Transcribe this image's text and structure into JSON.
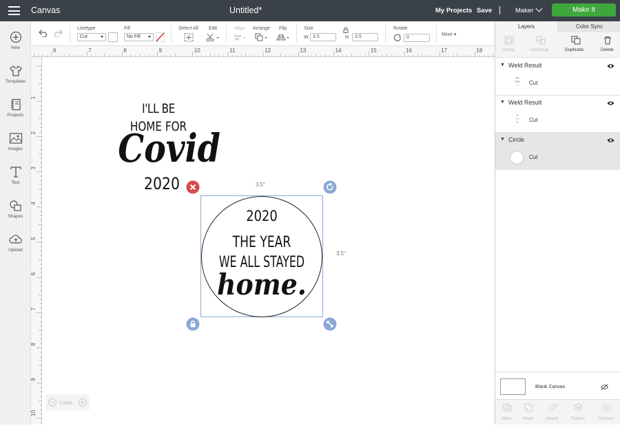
{
  "topbar": {
    "app_title": "Canvas",
    "doc_title": "Untitled*",
    "my_projects": "My Projects",
    "save": "Save",
    "machine": "Maker",
    "make_it": "Make It"
  },
  "toolbar": {
    "linetype_label": "Linetype",
    "linetype_value": "Cut",
    "fill_label": "Fill",
    "fill_value": "No Fill",
    "select_all": "Select All",
    "edit": "Edit",
    "align": "Align",
    "arrange": "Arrange",
    "flip": "Flip",
    "size_label": "Size",
    "w_label": "W",
    "w_value": "3.5",
    "h_label": "H",
    "h_value": "3.5",
    "rotate_label": "Rotate",
    "rotate_value": "0",
    "more": "More"
  },
  "left_rail": {
    "items": [
      {
        "label": "New",
        "icon": "plus-circle-icon"
      },
      {
        "label": "Templates",
        "icon": "tshirt-icon"
      },
      {
        "label": "Projects",
        "icon": "notebook-icon"
      },
      {
        "label": "Images",
        "icon": "image-icon"
      },
      {
        "label": "Text",
        "icon": "text-t-icon"
      },
      {
        "label": "Shapes",
        "icon": "shapes-icon"
      },
      {
        "label": "Upload",
        "icon": "cloud-upload-icon"
      }
    ]
  },
  "ruler": {
    "top": [
      "6",
      "7",
      "8",
      "9",
      "10",
      "11",
      "12",
      "13",
      "14",
      "15",
      "16",
      "17",
      "18"
    ],
    "left": [
      "1",
      "2",
      "3",
      "4",
      "5",
      "6",
      "7",
      "8",
      "9",
      "10"
    ]
  },
  "canvas": {
    "design1": {
      "line1": "I'LL BE",
      "line2": "HOME FOR",
      "line3": "Covid",
      "line4": "2020"
    },
    "design2": {
      "line1": "2020",
      "line2": "THE YEAR",
      "line3": "WE ALL STAYED",
      "line4": "home."
    },
    "width_dim": "3.5\"",
    "height_dim": "3.5\""
  },
  "zoom": {
    "value": "100%"
  },
  "right_panel": {
    "tabs": [
      "Layers",
      "Color Sync"
    ],
    "actions": [
      {
        "label": "Group",
        "enabled": false
      },
      {
        "label": "UnGroup",
        "enabled": false
      },
      {
        "label": "Duplicate",
        "enabled": true
      },
      {
        "label": "Delete",
        "enabled": true
      }
    ],
    "layers": [
      {
        "name": "Weld Result",
        "type": "Cut",
        "selected": false
      },
      {
        "name": "Weld Result",
        "type": "Cut",
        "selected": false
      },
      {
        "name": "Circle",
        "type": "Cut",
        "selected": true
      }
    ],
    "blank_canvas": "Blank Canvas",
    "bottom_actions": [
      "Slice",
      "Weld",
      "Attach",
      "Flatten",
      "Contour"
    ]
  },
  "colors": {
    "topbar": "#3b4148",
    "make_it": "#3ea83c",
    "selection": "#8aa8d6",
    "delete_handle": "#d84a4a"
  }
}
